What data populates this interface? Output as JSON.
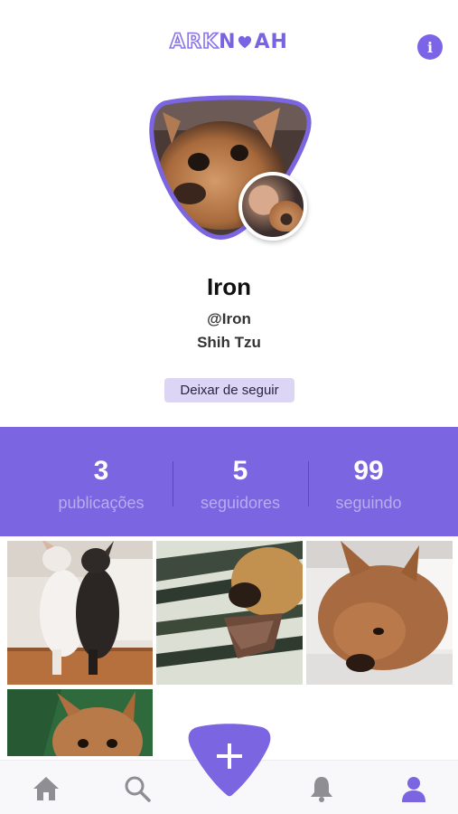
{
  "header": {
    "logo_part1": "ARK",
    "logo_part2": "AH",
    "info_label": "i"
  },
  "profile": {
    "name": "Iron",
    "handle": "@Iron",
    "breed": "Shih Tzu",
    "follow_button": "Deixar de seguir"
  },
  "stats": [
    {
      "value": "3",
      "label": "publicações"
    },
    {
      "value": "5",
      "label": "seguidores"
    },
    {
      "value": "99",
      "label": "seguindo"
    }
  ],
  "colors": {
    "accent": "#7b65e0",
    "follow_bg": "#dcd5f6",
    "stat_label": "#b9acf0"
  },
  "posts": [
    {
      "icon": "photo-two-french-bulldogs-standing"
    },
    {
      "icon": "photo-french-bulldog-chewing-treat"
    },
    {
      "icon": "photo-french-bulldog-lying"
    },
    {
      "icon": "photo-french-bulldog-on-green-blanket"
    }
  ],
  "nav": [
    {
      "icon": "home-icon"
    },
    {
      "icon": "search-icon"
    },
    {
      "icon": "add-icon"
    },
    {
      "icon": "bell-icon"
    },
    {
      "icon": "profile-icon"
    }
  ]
}
